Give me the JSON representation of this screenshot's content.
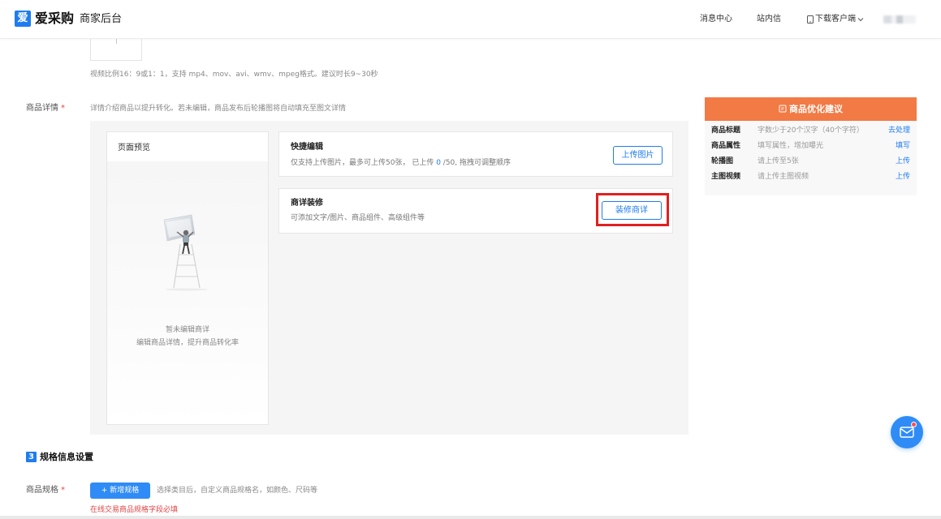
{
  "header": {
    "logo_mark": "爱",
    "logo_text": "爱采购",
    "subtitle": "商家后台",
    "nav": [
      "消息中心",
      "站内信",
      "下载客户端"
    ]
  },
  "video": {
    "hint": "视频比例16：9或1：1，支持 mp4、mov、avi、wmv、mpeg格式。建议时长9~30秒"
  },
  "detail": {
    "label": "商品详情",
    "required_mark": "*",
    "hint": "详情介绍商品以提升转化。若未编辑，商品发布后轮播图将自动填充至图文详情",
    "preview": {
      "title": "页面预览",
      "empty_line1": "暂未编辑商详",
      "empty_line2": "编辑商品详情，提升商品转化率"
    },
    "quick_edit": {
      "title": "快捷编辑",
      "desc_prefix": "仅支持上传图片，最多可上传50张， 已上传 ",
      "uploaded_count": "0",
      "desc_suffix": " /50, 拖拽可调整顺序",
      "button": "上传图片"
    },
    "decor": {
      "title": "商详装修",
      "desc": "可添加文字/图片、商品组件、高级组件等",
      "button": "装修商详"
    }
  },
  "suggestions": {
    "title": "商品优化建议",
    "rows": [
      {
        "name": "商品标题",
        "tip": "字数少于20个汉字（40个字符）",
        "action": "去处理"
      },
      {
        "name": "商品属性",
        "tip": "填写属性，增加曝光",
        "action": "填写"
      },
      {
        "name": "轮播图",
        "tip": "请上传至5张",
        "action": "上传"
      },
      {
        "name": "主图视频",
        "tip": "请上传主图视频",
        "action": "上传"
      }
    ]
  },
  "spec": {
    "section_number": "3",
    "section_title": "规格信息设置",
    "label": "商品规格",
    "required_mark": "*",
    "add_button": "+ 新增规格",
    "hint": "选择类目后，自定义商品规格名，如颜色、尺码等",
    "error": "在线交易商品规格字段必填"
  },
  "colors": {
    "primary": "#1f7cf0",
    "accent_orange": "#f27a45",
    "highlight_red": "#e02020",
    "error_red": "#e04545"
  }
}
